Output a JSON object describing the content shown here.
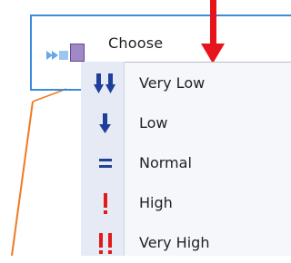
{
  "field": {
    "placeholder": "Choose"
  },
  "menu": {
    "items": [
      {
        "label": "Very Low",
        "icon": "double-down-arrow-icon"
      },
      {
        "label": "Low",
        "icon": "down-arrow-icon"
      },
      {
        "label": "Normal",
        "icon": "equals-icon"
      },
      {
        "label": "High",
        "icon": "exclamation-icon"
      },
      {
        "label": "Very High",
        "icon": "double-exclamation-icon"
      }
    ]
  },
  "colors": {
    "arrow": "#e8141b",
    "frame": "#3b8bd8",
    "menu_icon_blue": "#1f3f9a",
    "menu_icon_red": "#e11b1b",
    "connector": "#f07a22"
  }
}
